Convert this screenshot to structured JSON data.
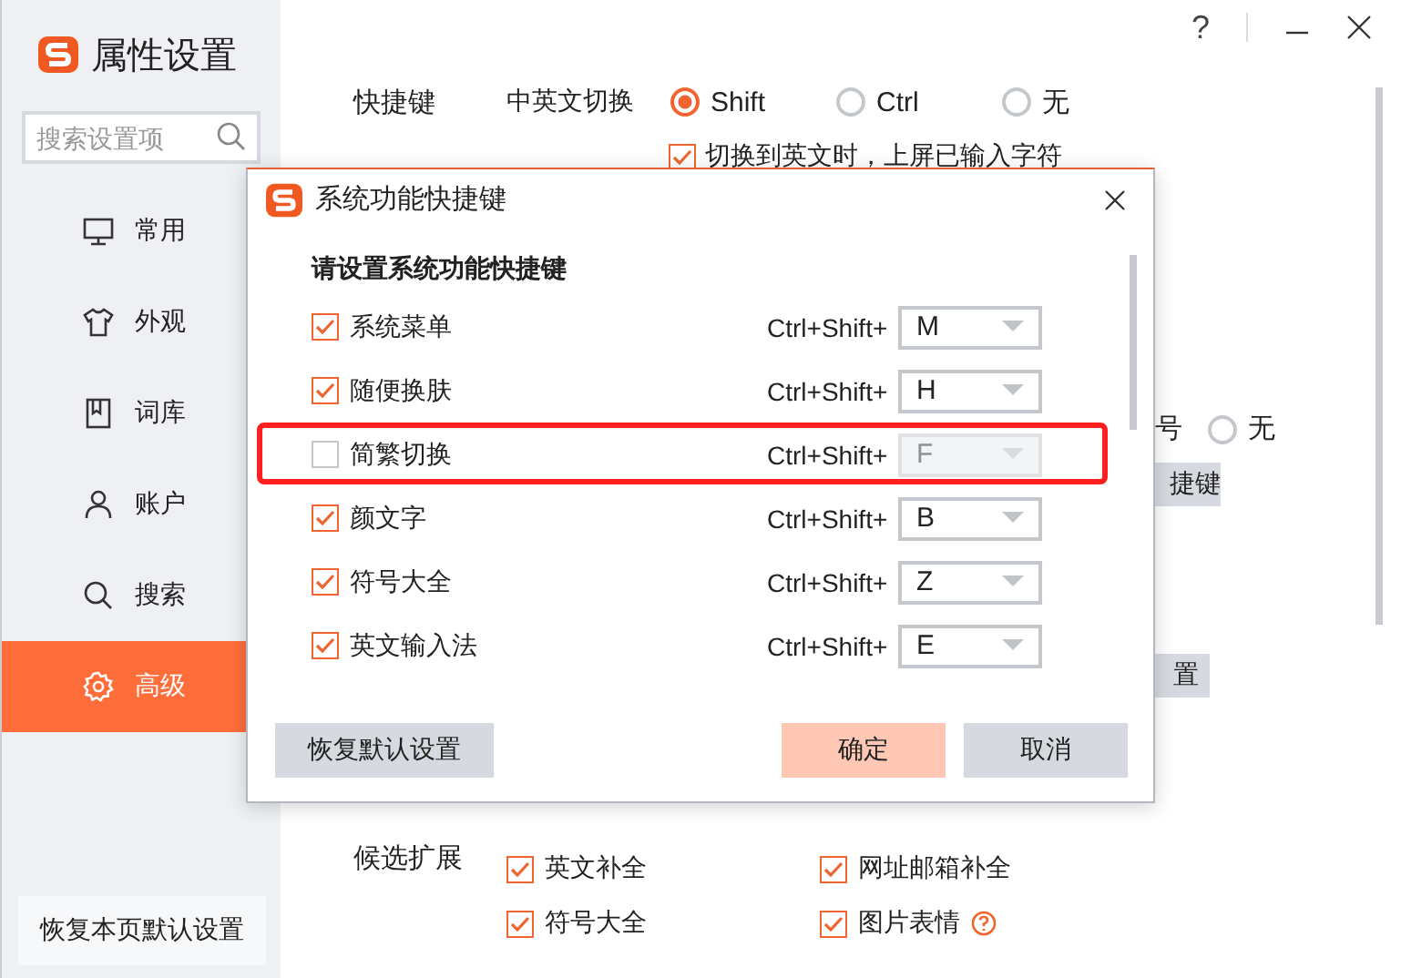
{
  "app": {
    "title": "属性设置",
    "help": "?"
  },
  "search": {
    "placeholder": "搜索设置项"
  },
  "sidebar": {
    "items": [
      {
        "label": "常用",
        "kind": "monitor",
        "selected": false
      },
      {
        "label": "外观",
        "kind": "shirt",
        "selected": false
      },
      {
        "label": "词库",
        "kind": "book",
        "selected": false
      },
      {
        "label": "账户",
        "kind": "person",
        "selected": false
      },
      {
        "label": "搜索",
        "kind": "search",
        "selected": false
      },
      {
        "label": "高级",
        "kind": "gear",
        "selected": true
      }
    ],
    "reset_button": "恢复本页默认设置"
  },
  "hotkey": {
    "label": "快捷键",
    "switch_label": "中英文切换",
    "options": [
      {
        "label": "Shift",
        "selected": true
      },
      {
        "label": "Ctrl",
        "selected": false
      },
      {
        "label": "无",
        "selected": false
      }
    ],
    "commit": {
      "label": "切换到英文时，上屏已输入字符",
      "checked": true
    }
  },
  "covered": {
    "radio_tail": "号",
    "radio_none": {
      "label": "无",
      "selected": false
    },
    "button_1": "捷键",
    "button_2": "置"
  },
  "candidate": {
    "label": "候选扩展",
    "options": [
      {
        "label": "英文补全",
        "checked": true,
        "help": false
      },
      {
        "label": "网址邮箱补全",
        "checked": true,
        "help": false
      },
      {
        "label": "符号大全",
        "checked": true,
        "help": false
      },
      {
        "label": "图片表情",
        "checked": true,
        "help": true
      }
    ]
  },
  "dialog": {
    "title": "系统功能快捷键",
    "heading": "请设置系统功能快捷键",
    "rows": [
      {
        "label": "系统菜单",
        "checked": true,
        "modifier": "Ctrl+Shift+",
        "key": "M",
        "highlighted": false
      },
      {
        "label": "随便换肤",
        "checked": true,
        "modifier": "Ctrl+Shift+",
        "key": "H",
        "highlighted": false
      },
      {
        "label": "简繁切换",
        "checked": false,
        "modifier": "Ctrl+Shift+",
        "key": "F",
        "highlighted": true
      },
      {
        "label": "颜文字",
        "checked": true,
        "modifier": "Ctrl+Shift+",
        "key": "B",
        "highlighted": false
      },
      {
        "label": "符号大全",
        "checked": true,
        "modifier": "Ctrl+Shift+",
        "key": "Z",
        "highlighted": false
      },
      {
        "label": "英文输入法",
        "checked": true,
        "modifier": "Ctrl+Shift+",
        "key": "E",
        "highlighted": false
      }
    ],
    "restore_button": "恢复默认设置",
    "ok_button": "确定",
    "cancel_button": "取消"
  }
}
